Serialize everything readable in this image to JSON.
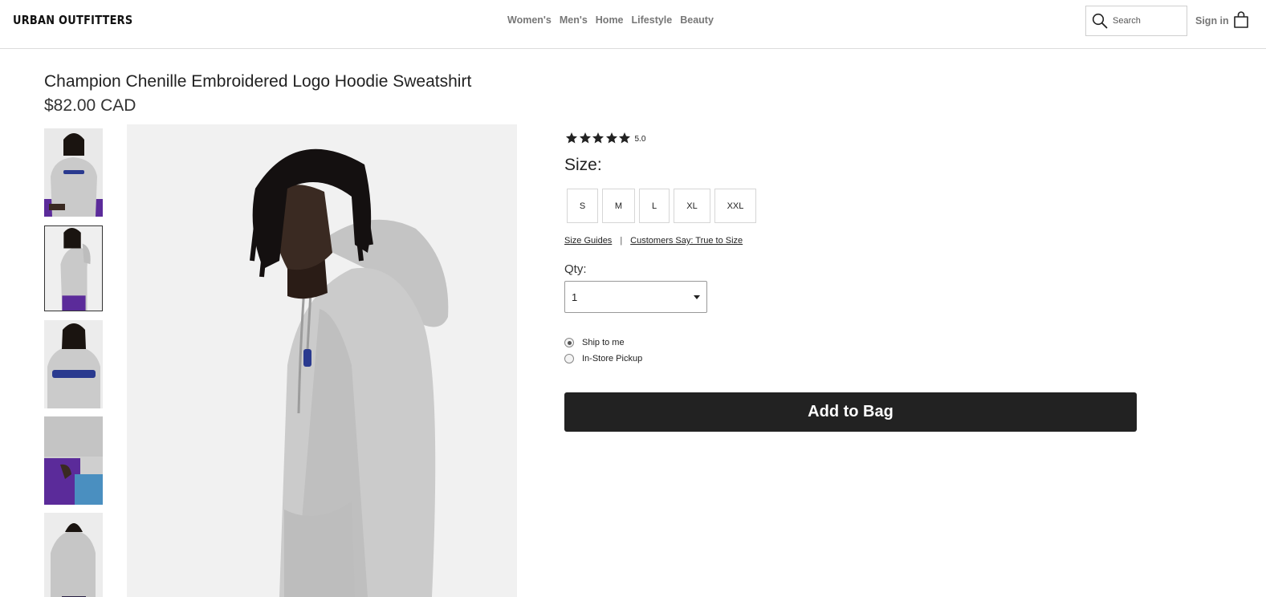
{
  "header": {
    "logo": "URBAN OUTFITTERS",
    "nav": [
      "Women's",
      "Men's",
      "Home",
      "Lifestyle",
      "Beauty"
    ],
    "search_placeholder": "Search",
    "signin_label": "Sign in"
  },
  "product": {
    "title": "Champion Chenille Embroidered Logo Hoodie Sweatshirt",
    "price": "$82.00 CAD",
    "rating_stars": 5,
    "rating_value": "5.0",
    "size_label": "Size:",
    "sizes": [
      "S",
      "M",
      "L",
      "XL",
      "XXL"
    ],
    "size_guides_label": "Size Guides",
    "separator": "|",
    "fit_label": "Customers Say: True to Size",
    "qty_label": "Qty:",
    "qty_value": "1",
    "delivery_options": [
      {
        "label": "Ship to me",
        "checked": true
      },
      {
        "label": "In-Store Pickup",
        "checked": false
      }
    ],
    "add_to_bag_label": "Add to Bag",
    "thumbnail_count": 5,
    "selected_thumbnail": 2
  },
  "colors": {
    "accent": "#222222",
    "hoodie_gray": "#c9c9c9",
    "pants_purple": "#5b2b9a",
    "logo_blue": "#2a3a8f"
  }
}
